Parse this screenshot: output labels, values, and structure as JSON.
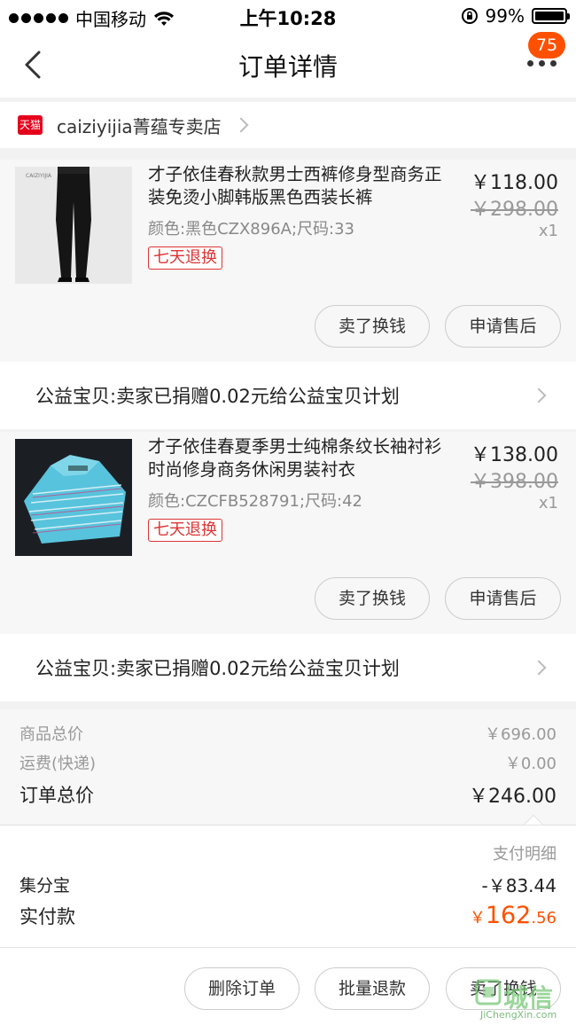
{
  "status": {
    "carrier": "中国移动",
    "time": "上午10:28",
    "battery": "99%"
  },
  "nav": {
    "title": "订单详情",
    "badge": "75"
  },
  "shop": {
    "icon_text": "天猫",
    "name": "caiziyijia菁蕴专卖店"
  },
  "items": [
    {
      "title": "才子依佳春秋款男士西裤修身型商务正装免烫小脚韩版黑色西装长裤",
      "sku": "颜色:黑色CZX896A;尺码:33",
      "tag": "七天退换",
      "price": "￥118.00",
      "orig_price": "￥298.00",
      "qty": "x1",
      "btn_sell": "卖了换钱",
      "btn_after": "申请售后",
      "charity": "公益宝贝:卖家已捐赠0.02元给公益宝贝计划"
    },
    {
      "title": "才子依佳春夏季男士纯棉条纹长袖衬衫时尚修身商务休闲男装衬衣",
      "sku": "颜色:CZCFB528791;尺码:42",
      "tag": "七天退换",
      "price": "￥138.00",
      "orig_price": "￥398.00",
      "qty": "x1",
      "btn_sell": "卖了换钱",
      "btn_after": "申请售后",
      "charity": "公益宝贝:卖家已捐赠0.02元给公益宝贝计划"
    }
  ],
  "totals": {
    "goods_label": "商品总价",
    "goods_value": "￥696.00",
    "shipping_label": "运费(快递)",
    "shipping_value": "￥0.00",
    "order_label": "订单总价",
    "order_value": "￥246.00"
  },
  "payment": {
    "detail_label": "支付明细",
    "points_label": "集分宝",
    "points_value": "-￥83.44",
    "paid_label": "实付款",
    "paid_symbol": "￥",
    "paid_int": "162",
    "paid_dec": ".56"
  },
  "actions": {
    "delete": "删除订单",
    "batch_refund": "批量退款",
    "sell": "卖了换钱"
  },
  "watermark": {
    "logo": "城信",
    "url": "JiChengXin.com"
  },
  "colors": {
    "accent": "#ff5000",
    "tmall_red": "#e5001b"
  }
}
